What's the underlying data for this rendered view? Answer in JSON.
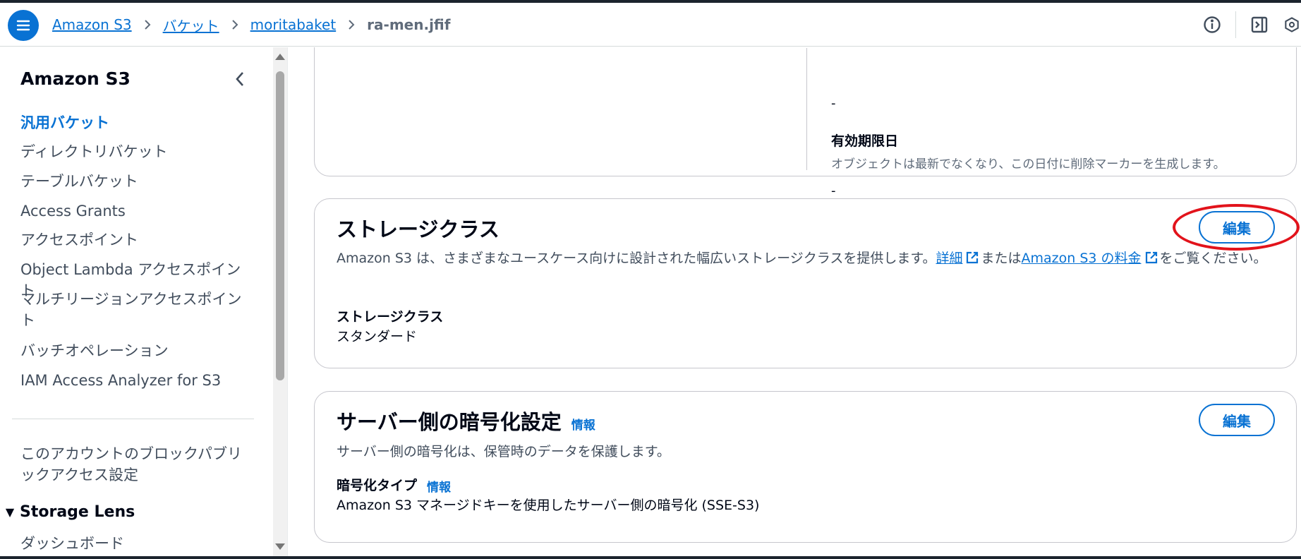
{
  "header": {
    "breadcrumbs": [
      "Amazon S3",
      "バケット",
      "moritabaket"
    ],
    "current": "ra-men.jfif"
  },
  "sidebar": {
    "title": "Amazon S3",
    "items": [
      {
        "label": "汎用バケット"
      },
      {
        "label": "ディレクトリバケット"
      },
      {
        "label": "テーブルバケット"
      },
      {
        "label": "Access Grants"
      },
      {
        "label": "アクセスポイント"
      },
      {
        "label": "Object Lambda アクセスポイント"
      },
      {
        "label": "マルチリージョンアクセスポイント"
      },
      {
        "label": "バッチオペレーション"
      },
      {
        "label": "IAM Access Analyzer for S3"
      },
      {
        "label": "このアカウントのブロックパブリックアクセス設定"
      }
    ],
    "section": {
      "label": "Storage Lens",
      "items": [
        {
          "label": "ダッシュボード"
        }
      ]
    }
  },
  "lifecycle": {
    "dash_top": "-",
    "expiry_label": "有効期限日",
    "expiry_desc": "オブジェクトは最新でなくなり、この日付に削除マーカーを生成します。",
    "expiry_value": "-"
  },
  "storage_class": {
    "title": "ストレージクラス",
    "edit_label": "編集",
    "desc_part1": "Amazon S3 は、さまざまなユースケース向けに設計された幅広いストレージクラスを提供します。",
    "link_details": "詳細",
    "desc_part2": "または",
    "link_pricing": "Amazon S3 の料金",
    "desc_part3": "をご覧ください。",
    "field_label": "ストレージクラス",
    "field_value": "スタンダード"
  },
  "encryption": {
    "title": "サーバー側の暗号化設定",
    "info_label": "情報",
    "edit_label": "編集",
    "desc": "サーバー側の暗号化は、保管時のデータを保護します。",
    "type_label": "暗号化タイプ",
    "type_info": "情報",
    "type_value": "Amazon S3 マネージドキーを使用したサーバー側の暗号化 (SSE-S3)"
  },
  "colors": {
    "accent": "#0972d3",
    "highlight": "#e2131b"
  }
}
